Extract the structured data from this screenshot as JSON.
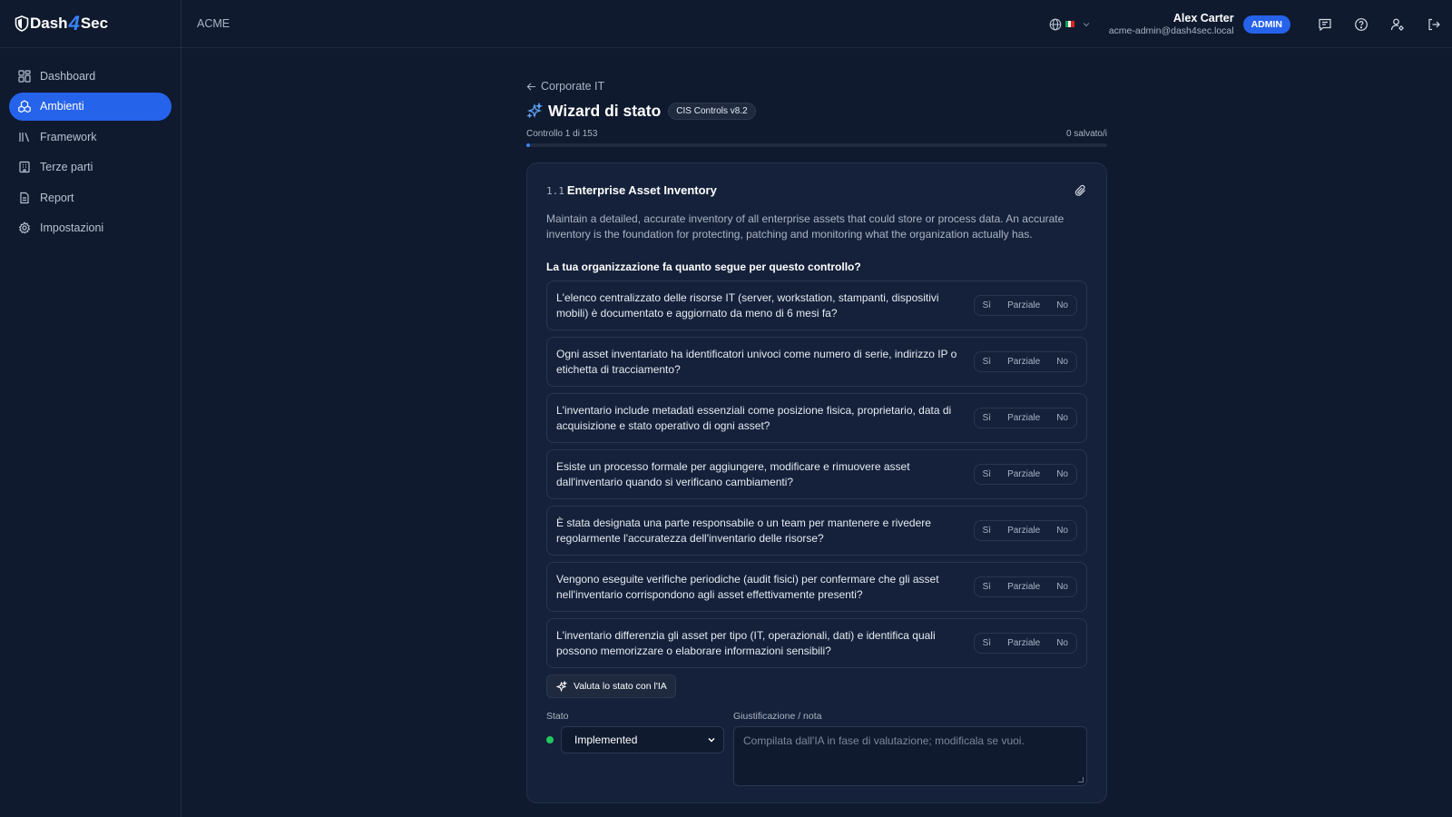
{
  "brand": {
    "part1": "Dash",
    "part2": "4",
    "part3": "Sec"
  },
  "sidebar": {
    "items": [
      {
        "label": "Dashboard",
        "icon": "dashboard-icon"
      },
      {
        "label": "Ambienti",
        "icon": "environments-icon",
        "active": true
      },
      {
        "label": "Framework",
        "icon": "library-icon"
      },
      {
        "label": "Terze parti",
        "icon": "building-icon"
      },
      {
        "label": "Report",
        "icon": "document-icon"
      },
      {
        "label": "Impostazioni",
        "icon": "gear-icon"
      }
    ]
  },
  "topbar": {
    "org": "ACME",
    "user_name": "Alex Carter",
    "user_email": "acme-admin@dash4sec.local",
    "role": "ADMIN"
  },
  "page": {
    "back_label": "Corporate IT",
    "title": "Wizard di stato",
    "framework_badge": "CIS Controls v8.2",
    "progress_label": "Controllo 1 di 153",
    "saved_label": "0 salvato/i",
    "progress_fraction": 0.0065
  },
  "control": {
    "id": "1.1",
    "name": "Enterprise Asset Inventory",
    "description": "Maintain a detailed, accurate inventory of all enterprise assets that could store or process data. An accurate inventory is the foundation for protecting, patching and monitoring what the organization actually has.",
    "question": "La tua organizzazione fa quanto segue per questo controllo?",
    "options": {
      "yes": "Sì",
      "partial": "Parziale",
      "no": "No"
    },
    "items": [
      "L'elenco centralizzato delle risorse IT (server, workstation, stampanti, dispositivi mobili) è documentato e aggiornato da meno di 6 mesi fa?",
      "Ogni asset inventariato ha identificatori univoci come numero di serie, indirizzo IP o etichetta di tracciamento?",
      "L'inventario include metadati essenziali come posizione fisica, proprietario, data di acquisizione e stato operativo di ogni asset?",
      "Esiste un processo formale per aggiungere, modificare e rimuovere asset dall'inventario quando si verificano cambiamenti?",
      "È stata designata una parte responsabile o un team per mantenere e rivedere regolarmente l'accuratezza dell'inventario delle risorse?",
      "Vengono eseguite verifiche periodiche (audit fisici) per confermare che gli asset nell'inventario corrispondono agli asset effettivamente presenti?",
      "L'inventario differenzia gli asset per tipo (IT, operazionali, dati) e identifica quali possono memorizzare o elaborare informazioni sensibili?"
    ],
    "ai_button": "Valuta lo stato con l'IA",
    "status_label": "Stato",
    "status_value": "Implemented",
    "status_color": "#22c55e",
    "note_label": "Giustificazione / nota",
    "note_placeholder": "Compilata dall'IA in fase di valutazione; modificala se vuoi."
  }
}
